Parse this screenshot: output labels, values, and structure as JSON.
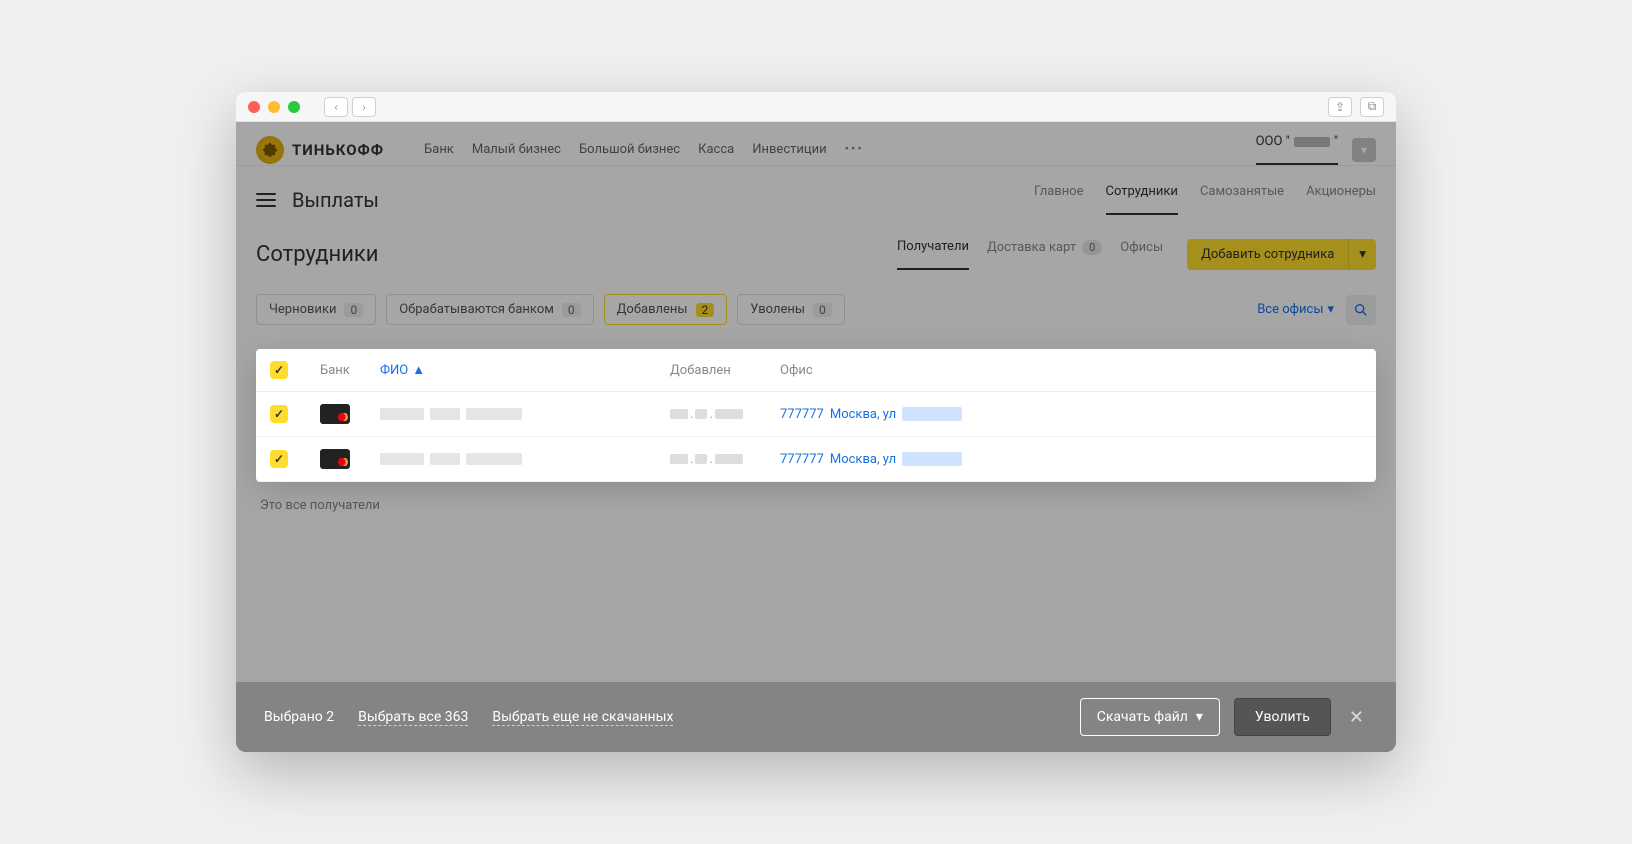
{
  "brand": "ТИНЬКОФФ",
  "top_nav": {
    "items": [
      "Банк",
      "Малый бизнес",
      "Большой бизнес",
      "Касса",
      "Инвестиции"
    ],
    "more": "•••",
    "company_prefix": "ООО \""
  },
  "sub_nav": {
    "title": "Выплаты",
    "tabs": [
      "Главное",
      "Сотрудники",
      "Самозанятые",
      "Акционеры"
    ],
    "active": "Сотрудники"
  },
  "section": {
    "title": "Сотрудники",
    "tabs": [
      {
        "label": "Получатели",
        "active": true
      },
      {
        "label": "Доставка карт",
        "count": 0
      },
      {
        "label": "Офисы"
      }
    ],
    "add_button": "Добавить сотрудника"
  },
  "filters": {
    "chips": [
      {
        "label": "Черновики",
        "count": 0
      },
      {
        "label": "Обрабатываются банком",
        "count": 0
      },
      {
        "label": "Добавлены",
        "count": 2,
        "active": true
      },
      {
        "label": "Уволены",
        "count": 0
      }
    ],
    "office_dropdown": "Все офисы"
  },
  "table": {
    "headers": {
      "bank": "Банк",
      "fio": "ФИО",
      "added": "Добавлен",
      "office": "Офис"
    },
    "rows": [
      {
        "office_code": "777777",
        "office_text": "Москва, ул"
      },
      {
        "office_code": "777777",
        "office_text": "Москва, ул"
      }
    ],
    "end_note": "Это все получатели"
  },
  "action_bar": {
    "selected": "Выбрано 2",
    "select_all": "Выбрать все 363",
    "select_not_downloaded": "Выбрать еще не скачанных",
    "download": "Скачать файл",
    "dismiss": "Уволить"
  }
}
